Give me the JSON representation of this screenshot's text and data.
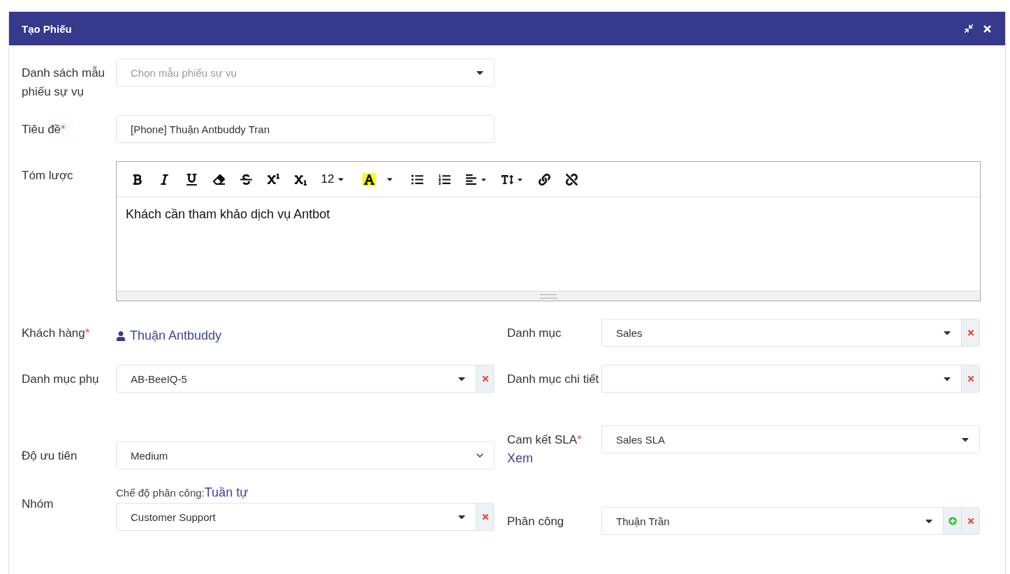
{
  "window": {
    "title": "Tạo Phiếu"
  },
  "template": {
    "label": "Danh sách mẫu phiếu sự vụ",
    "placeholder": "Chọn mẫu phiếu sự vụ"
  },
  "title_field": {
    "label": "Tiêu đề",
    "required_mark": "*",
    "value": "[Phone] Thuận  Antbuddy Tran"
  },
  "summary": {
    "label": "Tóm lược",
    "content": "Khách cần tham khảo dịch vụ Antbot",
    "toolbar": [
      {
        "kind": "bold"
      },
      {
        "kind": "italic"
      },
      {
        "kind": "underline"
      },
      {
        "kind": "eraser"
      },
      {
        "kind": "strike"
      },
      {
        "kind": "superscript"
      },
      {
        "kind": "subscript"
      },
      {
        "kind": "size",
        "text": "12"
      },
      {
        "kind": "highlight"
      },
      {
        "kind": "bullets"
      },
      {
        "kind": "numbers"
      },
      {
        "kind": "align"
      },
      {
        "kind": "textsize"
      },
      {
        "kind": "link"
      },
      {
        "kind": "unlink"
      }
    ]
  },
  "left_fields": [
    {
      "kind": "customer",
      "label": "Khách hàng",
      "required_mark": "*",
      "value": "Thuận Antbuddy"
    },
    {
      "kind": "select",
      "label": "Danh mục phụ",
      "value": "AB-BeeIQ-5",
      "clear": true,
      "add": false
    },
    {
      "kind": "native",
      "label": "Độ ưu tiên",
      "value": "Medium"
    },
    {
      "kind": "group",
      "label": "Nhóm",
      "mode_label": "Chế độ phân công:",
      "mode_value": "Tuần tự",
      "value": "Customer Support",
      "clear": true,
      "add": false
    }
  ],
  "right_fields": [
    {
      "kind": "select",
      "label": "Danh mục",
      "value": "Sales",
      "clear": true,
      "add": false
    },
    {
      "kind": "select",
      "label": "Danh mục chi tiết",
      "clear": true,
      "add": false
    },
    {
      "kind": "select",
      "label": "Cam kết SLA",
      "required_mark": "*",
      "link": "Xem",
      "value": "Sales SLA",
      "clear": false,
      "add": false
    },
    {
      "kind": "select",
      "label": "Phân công",
      "value": "Thuận Trần",
      "clear": true,
      "add": true
    }
  ]
}
